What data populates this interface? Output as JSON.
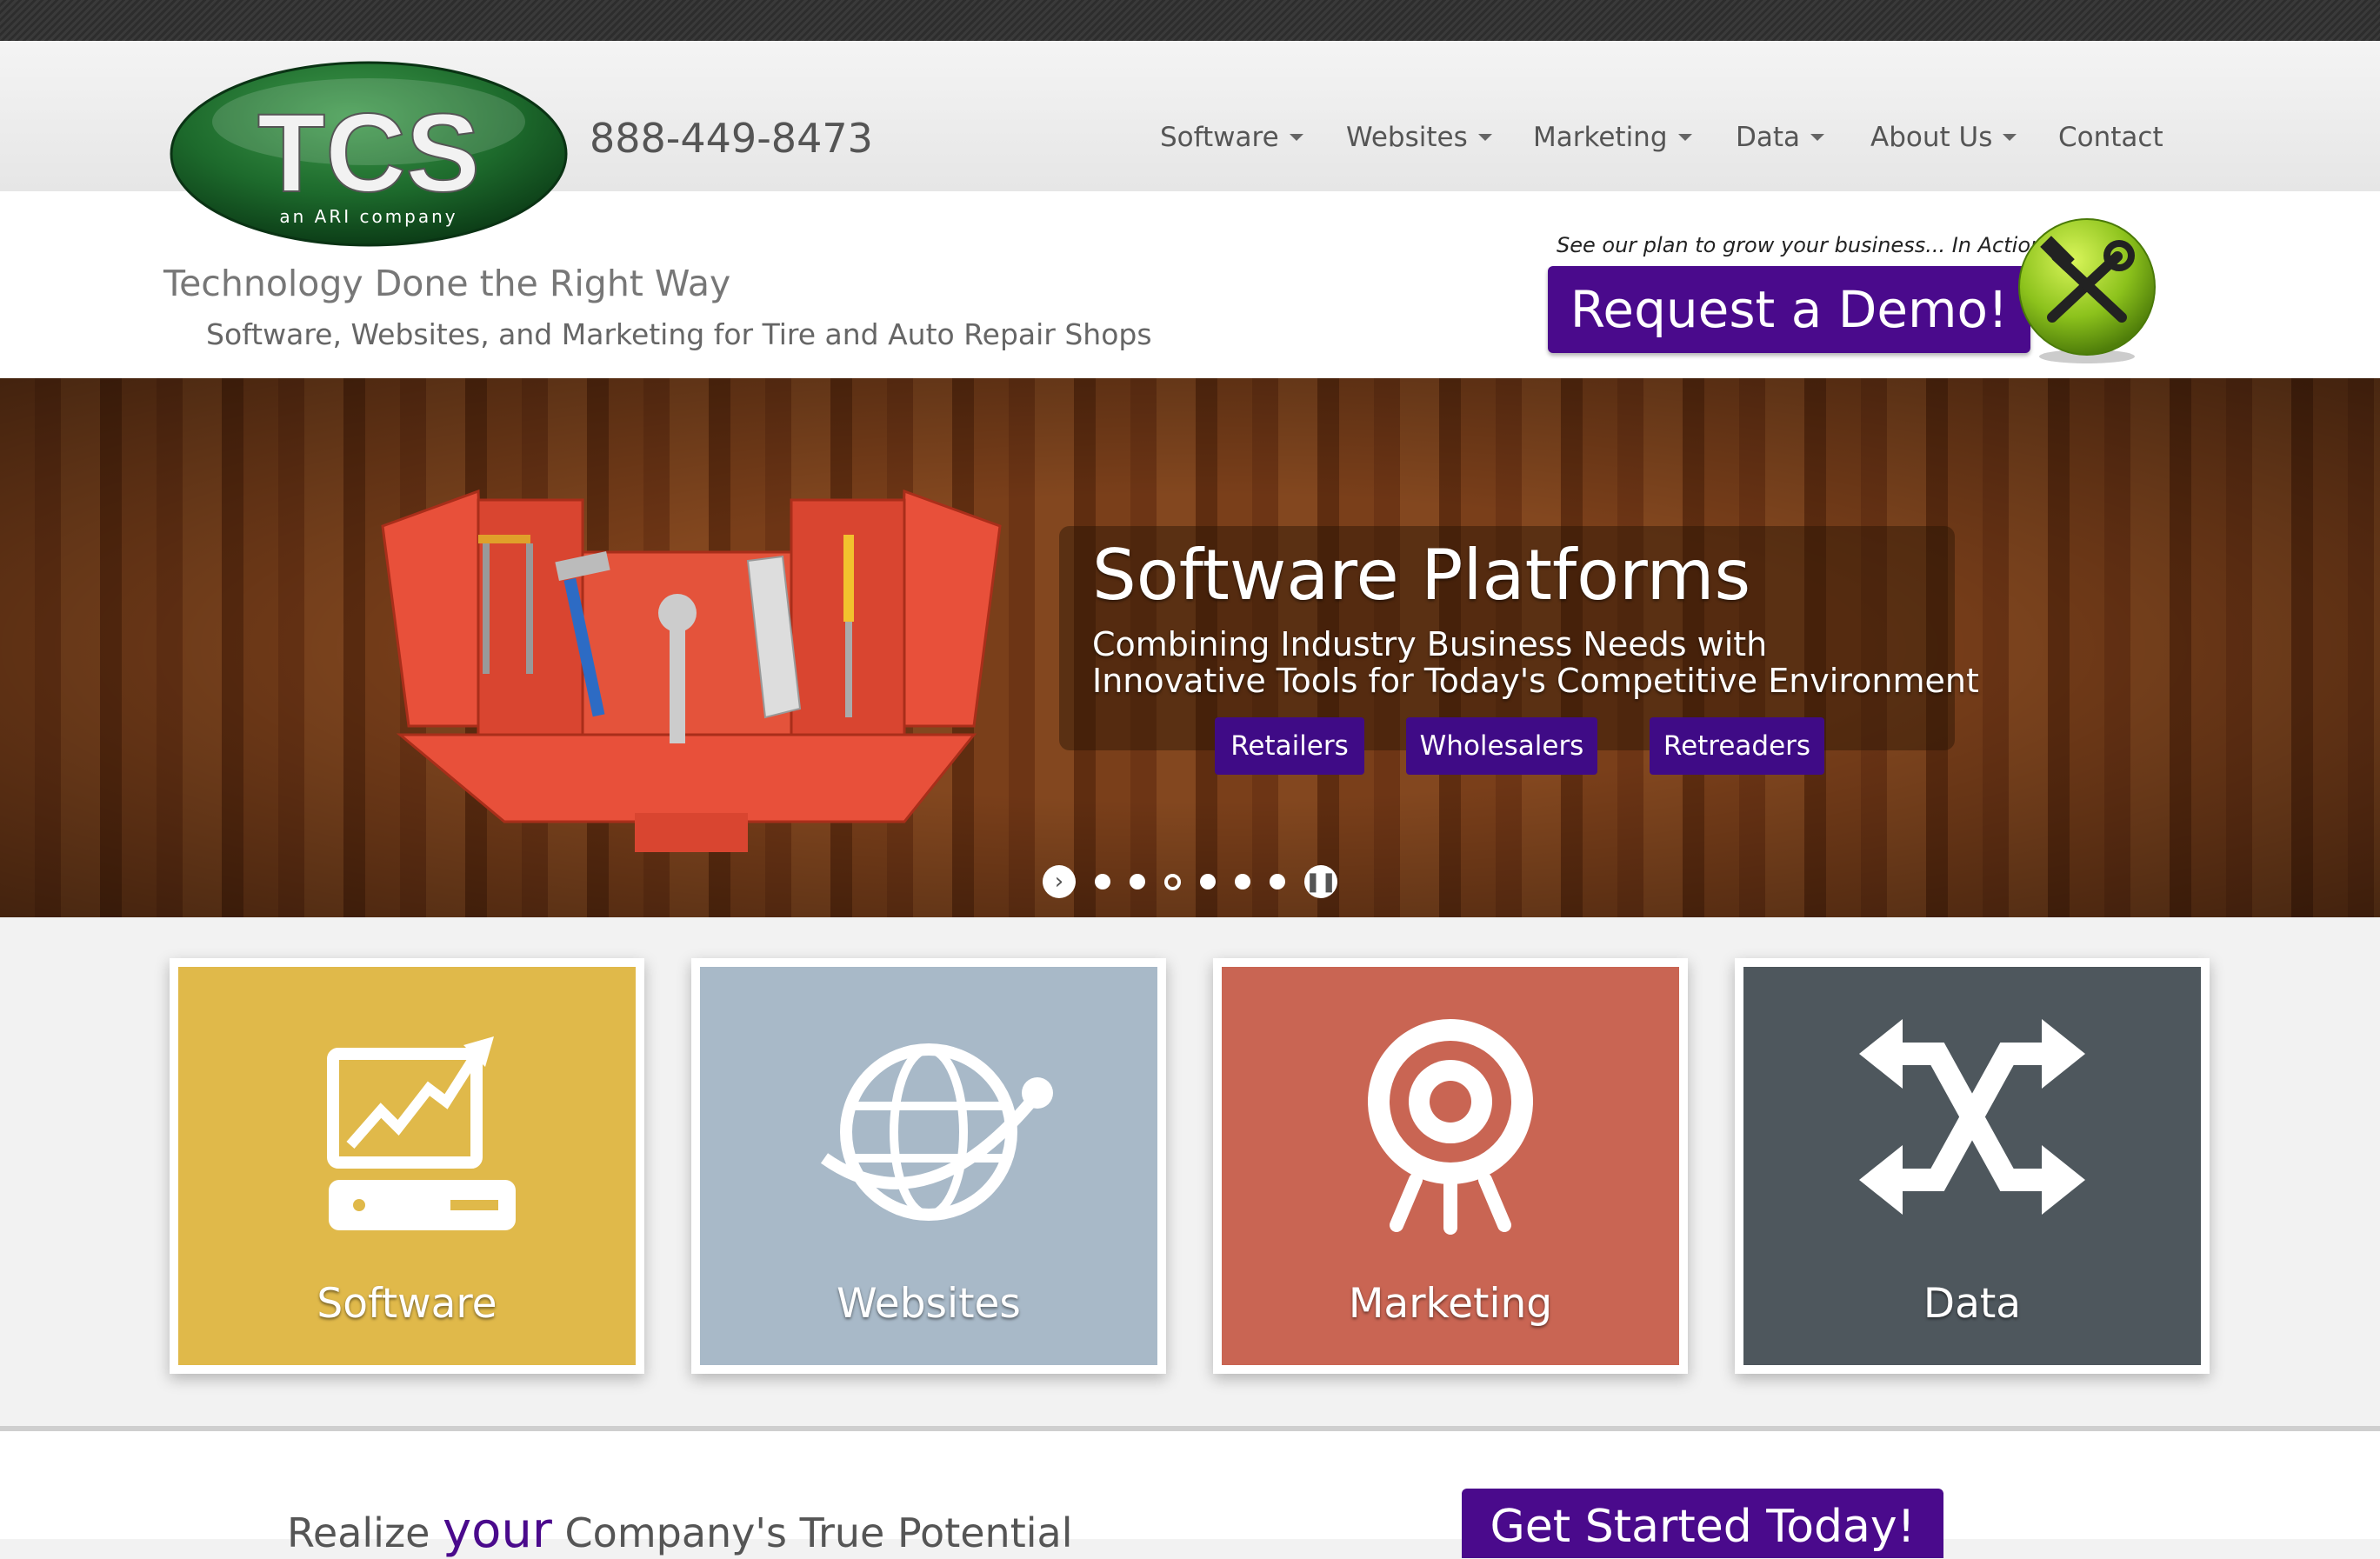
{
  "brand": {
    "logo_text": "TCS",
    "logo_sub": "an ARI company",
    "phone": "888-449-8473"
  },
  "nav": [
    {
      "label": "Software",
      "dropdown": true
    },
    {
      "label": "Websites",
      "dropdown": true
    },
    {
      "label": "Marketing",
      "dropdown": true
    },
    {
      "label": "Data",
      "dropdown": true
    },
    {
      "label": "About Us",
      "dropdown": true
    },
    {
      "label": "Contact",
      "dropdown": false
    }
  ],
  "header": {
    "tagline": "Technology Done the Right Way",
    "subtagline": "Software, Websites, and Marketing for Tire and Auto Repair Shops",
    "plan_text": "See our plan to grow your business... In Action!",
    "demo_button": "Request a Demo!"
  },
  "hero": {
    "title": "Software Platforms",
    "subtitle_line1": "Combining Industry Business Needs with",
    "subtitle_line2": "Innovative Tools for Today's Competitive Environment",
    "buttons": [
      "Retailers",
      "Wholesalers",
      "Retreaders"
    ],
    "slide_count": 6,
    "active_slide": 3
  },
  "cards": [
    {
      "label": "Software",
      "color": "#e0b94a"
    },
    {
      "label": "Websites",
      "color": "#a8b9c8"
    },
    {
      "label": "Marketing",
      "color": "#c96553"
    },
    {
      "label": "Data",
      "color": "#4e575d"
    }
  ],
  "bottom": {
    "realize_pre": "Realize ",
    "realize_your": "your",
    "realize_post": " Company's True Potential",
    "get_started": "Get Started Today!"
  },
  "colors": {
    "accent": "#4a0a8c",
    "logo_green": "#1f6b2f"
  }
}
